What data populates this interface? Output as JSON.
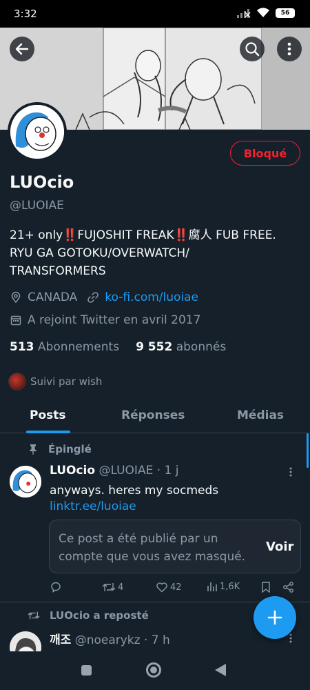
{
  "status_bar": {
    "time": "3:32",
    "battery": "56"
  },
  "profile": {
    "name": "LUOcio",
    "handle": "@LUOIAE",
    "blocked_label": "Bloqué",
    "bio": "21+ only‼️FUJOSHIT FREAK‼️腐人  FUB FREE.  RYU GA GOTOKU/OVERWATCH/ TRANSFORMERS",
    "location": "CANADA",
    "website": "ko-fi.com/luoiae",
    "joined": "A rejoint Twitter en avril 2017",
    "following_count": "513",
    "following_label": "Abonnements",
    "followers_count": "9 552",
    "followers_label": "abonnés",
    "followed_by": "Suivi par wish"
  },
  "tabs": [
    {
      "label": "Posts",
      "active": true
    },
    {
      "label": "Réponses",
      "active": false
    },
    {
      "label": "Médias",
      "active": false
    }
  ],
  "tweets": [
    {
      "context": "Épinglé",
      "name": "LUOcio",
      "handle_time": "@LUOIAE · 1 j",
      "text": "anyways. heres my socmeds",
      "link": "linktr.ee/luoiae",
      "quote_notice": "Ce post a été publié par un compte que vous avez masqué.",
      "quote_action": "Voir",
      "retweets": "4",
      "likes": "42",
      "views": "1,6K"
    },
    {
      "context": "LUOcio a reposté",
      "name": "깨조",
      "handle_time": "@noearykz · 7 h"
    }
  ],
  "colors": {
    "accent": "#1d9bf0",
    "blocked": "#f4212e",
    "background": "#15202b"
  },
  "icons": [
    "back-arrow-icon",
    "search-icon",
    "more-vertical-icon",
    "location-pin-icon",
    "link-icon",
    "calendar-icon",
    "pin-icon",
    "repost-icon",
    "reply-icon",
    "heart-icon",
    "views-icon",
    "bookmark-icon",
    "share-icon",
    "plus-icon"
  ]
}
